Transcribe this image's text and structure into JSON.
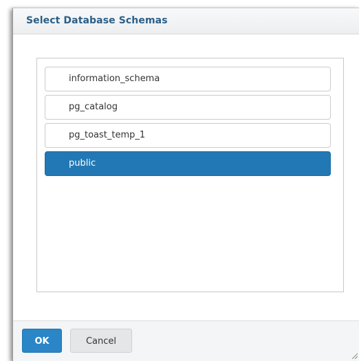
{
  "dialog": {
    "title": "Select Database Schemas"
  },
  "schemas": {
    "items": [
      {
        "label": "information_schema",
        "selected": false
      },
      {
        "label": "pg_catalog",
        "selected": false
      },
      {
        "label": "pg_toast_temp_1",
        "selected": false
      },
      {
        "label": "public",
        "selected": true
      }
    ]
  },
  "footer": {
    "ok_label": "OK",
    "cancel_label": "Cancel"
  },
  "colors": {
    "title": "#2b5f86",
    "selected_bg": "#2278b4",
    "ok_bg": "#2a86c6"
  }
}
